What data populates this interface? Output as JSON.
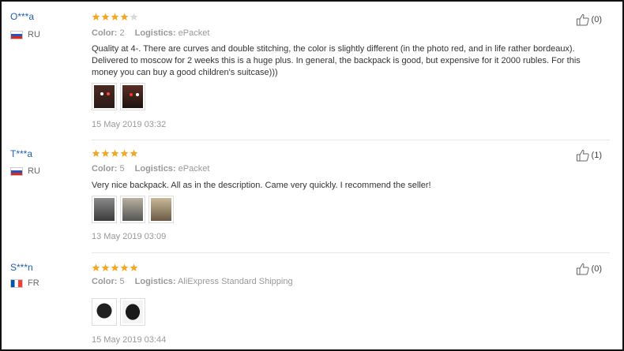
{
  "reviews": [
    {
      "buyer": "O***a",
      "country": "RU",
      "rating": 4,
      "color_label": "Color:",
      "color_value": "2",
      "logistics_label": "Logistics:",
      "logistics_value": "ePacket",
      "text": "Quality at 4-. There are curves and double stitching, the color is slightly different (in the photo red, and in life rather bordeaux). Delivered to moscow for 2 weeks this is a huge plus. In general, the backpack is good, but expensive for it 2000 rubles. For this money you can buy a good children's suitcase)))",
      "photo_count": 2,
      "date": "15 May 2019 03:32",
      "helpful_count": "(0)"
    },
    {
      "buyer": "T***a",
      "country": "RU",
      "rating": 5,
      "color_label": "Color:",
      "color_value": "5",
      "logistics_label": "Logistics:",
      "logistics_value": "ePacket",
      "text": "Very nice backpack. All as in the description. Came very quickly. I recommend the seller!",
      "photo_count": 3,
      "date": "13 May 2019 03:09",
      "helpful_count": "(1)"
    },
    {
      "buyer": "S***n",
      "country": "FR",
      "rating": 5,
      "color_label": "Color:",
      "color_value": "5",
      "logistics_label": "Logistics:",
      "logistics_value": "AliExpress Standard Shipping",
      "text": "",
      "photo_count": 2,
      "date": "15 May 2019 03:44",
      "helpful_count": "(0)"
    }
  ],
  "colors": {
    "buyer_link": "#1f5fb0",
    "star_filled": "#f5a623",
    "star_empty": "#d9d9d9",
    "meta_text": "#999999"
  }
}
